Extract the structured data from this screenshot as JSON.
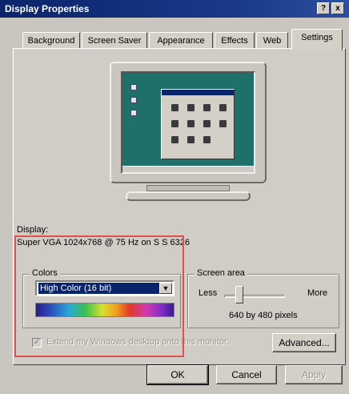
{
  "window": {
    "title": "Display Properties",
    "help_button": "?",
    "close_button": "x"
  },
  "tabs": [
    {
      "label": "Background",
      "active": false
    },
    {
      "label": "Screen Saver",
      "active": false
    },
    {
      "label": "Appearance",
      "active": false
    },
    {
      "label": "Effects",
      "active": false
    },
    {
      "label": "Web",
      "active": false
    },
    {
      "label": "Settings",
      "active": true
    }
  ],
  "display": {
    "label": "Display:",
    "value": "Super VGA 1024x768 @ 75 Hz on S S 6326"
  },
  "colors": {
    "group_title": "Colors",
    "selected": "High Color (16 bit)"
  },
  "screen_area": {
    "group_title": "Screen area",
    "less_label": "Less",
    "more_label": "More",
    "value_text": "640 by 480 pixels",
    "slider_level": 0.15
  },
  "extend_desktop": {
    "label": "Extend my Windows desktop onto this monitor.",
    "checked": true,
    "enabled": false
  },
  "buttons": {
    "advanced": "Advanced...",
    "ok": "OK",
    "cancel": "Cancel",
    "apply": "Apply"
  },
  "colors_palette": {
    "title_bar": "#0a246a",
    "desktop": "#1f6f6a",
    "highlight_box": "#e05050"
  }
}
